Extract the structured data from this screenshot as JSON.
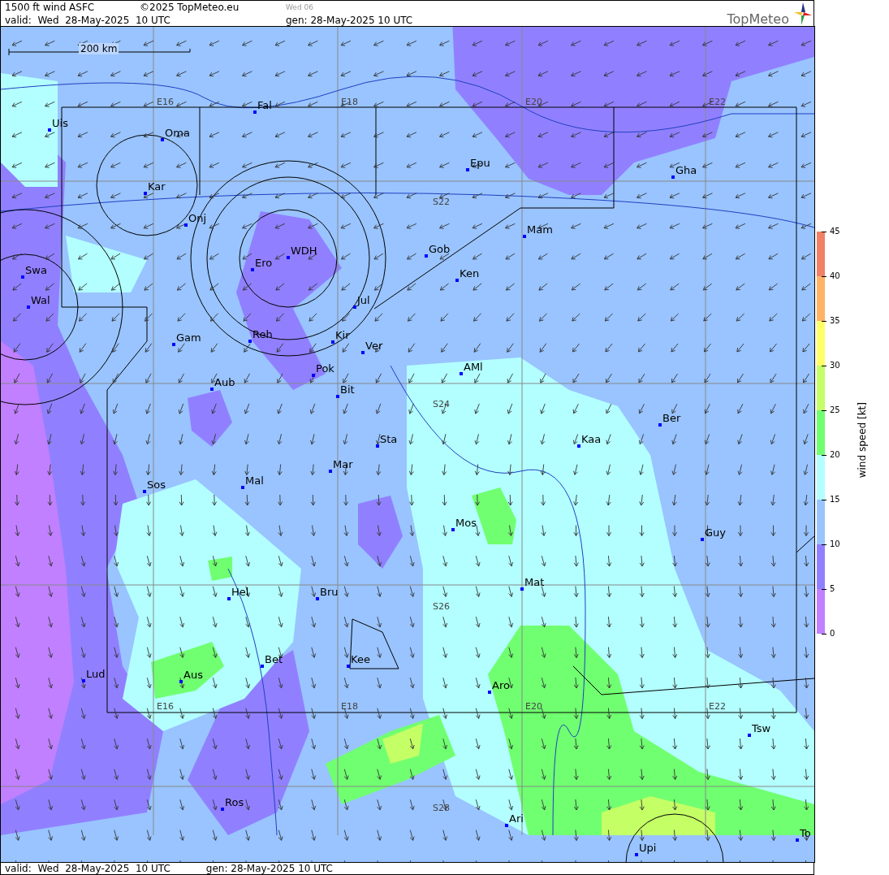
{
  "header": {
    "title": "1500 ft wind ASFC",
    "copyright": "©2025 TopMeteo.eu",
    "run": "Wed 06",
    "valid": "valid:  Wed  28-May-2025  10 UTC",
    "generated": "gen: 28-May-2025 10 UTC",
    "logo": "TopMeteo"
  },
  "map": {
    "scale": "200 km",
    "grid_labels": [
      "E16",
      "E18",
      "E20",
      "E22",
      "S22",
      "S24",
      "S26",
      "S28",
      "E16",
      "E18",
      "E20",
      "E22"
    ],
    "places": [
      "Uis",
      "Oma",
      "Fal",
      "Kar",
      "Onj",
      "Epu",
      "Gha",
      "Mam",
      "Gob",
      "WDH",
      "Ero",
      "Ken",
      "Swa",
      "Wal",
      "Jul",
      "Gam",
      "Reh",
      "Kir",
      "Ver",
      "AMl",
      "Pok",
      "Aub",
      "Bit",
      "Ber",
      "Sta",
      "Kaa",
      "Mar",
      "Mal",
      "Sos",
      "Mos",
      "Guy",
      "Mat",
      "Hel",
      "Bru",
      "Bet",
      "Kee",
      "Aus",
      "Lud",
      "Aro",
      "Tsw",
      "Ros",
      "Ari",
      "Upi",
      "To"
    ]
  },
  "legend": {
    "title": "wind speed [kt]",
    "ticks": [
      "45",
      "40",
      "35",
      "30",
      "25",
      "20",
      "15",
      "10",
      "5",
      "0"
    ],
    "bands": [
      {
        "color": "#f08066"
      },
      {
        "color": "#ffb366"
      },
      {
        "color": "#ffff66"
      },
      {
        "color": "#c4ff66"
      },
      {
        "color": "#70ff70"
      },
      {
        "color": "#b3ffff"
      },
      {
        "color": "#99c4ff"
      },
      {
        "color": "#9080ff"
      },
      {
        "color": "#c080ff"
      }
    ]
  },
  "footer": {
    "valid": "valid:  Wed  28-May-2025  10 UTC",
    "generated": "gen: 28-May-2025 10 UTC"
  }
}
